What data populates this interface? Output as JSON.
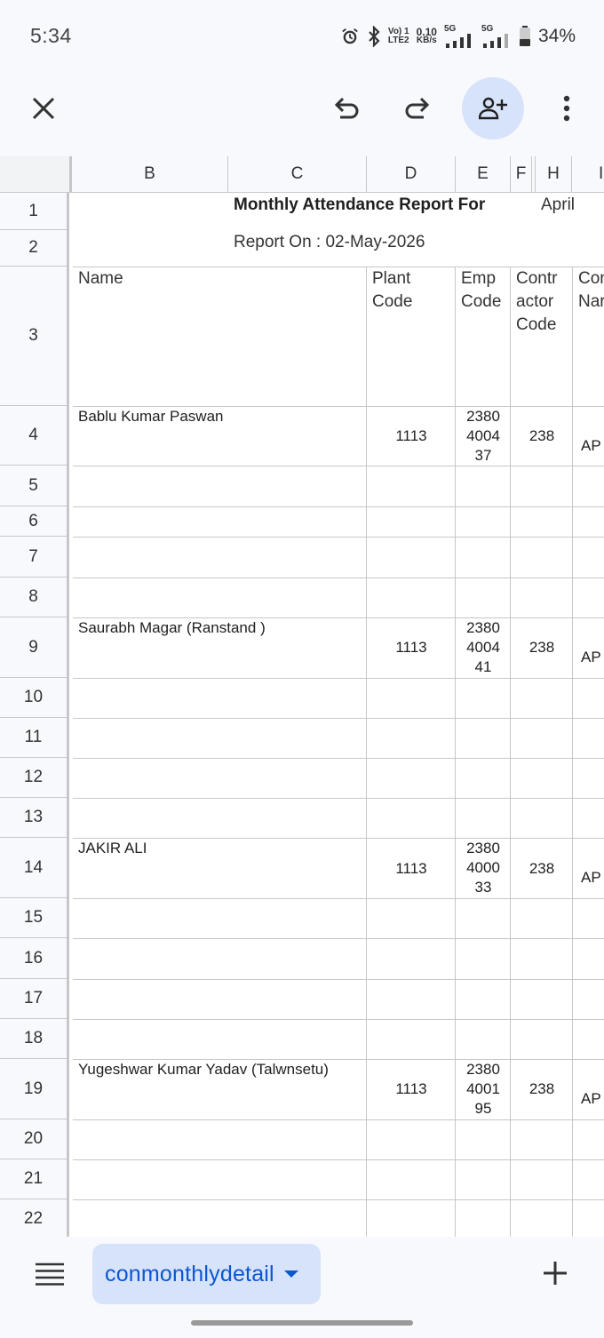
{
  "status_bar": {
    "time": "5:34",
    "signal_1": "Vo) 1",
    "signal_2": "LTE2",
    "speed_value": "0.10",
    "speed_unit": "KB/s",
    "net_1": "5G",
    "net_2": "5G",
    "battery": "34%"
  },
  "toolbar": {
    "close_icon": "close-icon",
    "undo_icon": "undo-icon",
    "redo_icon": "redo-icon",
    "share_icon": "add-person-icon",
    "more_icon": "more-vert-icon"
  },
  "columns": [
    "B",
    "C",
    "D",
    "E",
    "F",
    "H",
    "I"
  ],
  "rows": [
    "1",
    "2",
    "3",
    "4",
    "5",
    "6",
    "7",
    "8",
    "9",
    "10",
    "11",
    "12",
    "13",
    "14",
    "15",
    "16",
    "17",
    "18",
    "19",
    "20",
    "21",
    "22"
  ],
  "report": {
    "title": "Monthly Attendance Report For",
    "month": "April",
    "report_on": "Report On : 02-May-2026"
  },
  "headers": {
    "name": "Name",
    "plant_code": "Plant\nCode",
    "emp_code": "Emp\nCode",
    "contractor_code": "Contr\nactor\nCode",
    "contractor_name": "Con\nNar"
  },
  "employees": [
    {
      "name": "Bablu Kumar Paswan",
      "plant": "1113",
      "emp_code": "2380\n4004\n37",
      "contractor": "238",
      "contractor_name": "AP"
    },
    {
      "name": "Saurabh Magar (Ranstand )",
      "plant": "1113",
      "emp_code": "2380\n4004\n41",
      "contractor": "238",
      "contractor_name": "AP"
    },
    {
      "name": "JAKIR ALI",
      "plant": "1113",
      "emp_code": "2380\n4000\n33",
      "contractor": "238",
      "contractor_name": "AP"
    },
    {
      "name": "Yugeshwar Kumar Yadav (Talwnsetu)",
      "plant": "1113",
      "emp_code": "2380\n4001\n95",
      "contractor": "238",
      "contractor_name": "AP"
    }
  ],
  "bottom_bar": {
    "sheet_name": "conmonthlydetail",
    "menu_icon": "sheets-list-icon",
    "add_icon": "add-sheet-icon"
  }
}
